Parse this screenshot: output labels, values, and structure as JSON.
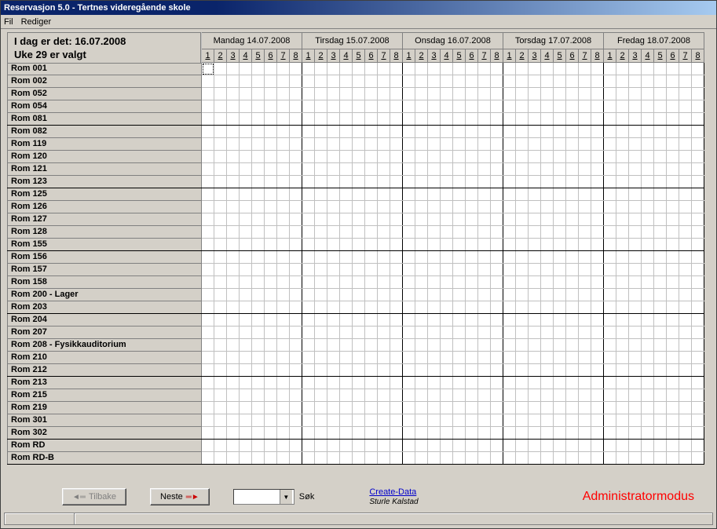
{
  "window": {
    "title": "Reservasjon 5.0 - Tertnes videregående skole"
  },
  "menu": {
    "file": "Fil",
    "edit": "Rediger"
  },
  "info": {
    "today_label": "I dag er det: 16.07.2008",
    "week_label": "Uke 29 er valgt"
  },
  "days": [
    {
      "label": "Mandag 14.07.2008"
    },
    {
      "label": "Tirsdag 15.07.2008"
    },
    {
      "label": "Onsdag 16.07.2008"
    },
    {
      "label": "Torsdag 17.07.2008"
    },
    {
      "label": "Fredag 18.07.2008"
    }
  ],
  "periods": [
    "1",
    "2",
    "3",
    "4",
    "5",
    "6",
    "7",
    "8"
  ],
  "rooms": [
    "Rom 001",
    "Rom 002",
    "Rom 052",
    "Rom 054",
    "Rom 081",
    "Rom 082",
    "Rom 119",
    "Rom 120",
    "Rom 121",
    "Rom 123",
    "Rom 125",
    "Rom 126",
    "Rom 127",
    "Rom 128",
    "Rom 155",
    "Rom 156",
    "Rom 157",
    "Rom 158",
    "Rom 200 - Lager",
    "Rom 203",
    "Rom 204",
    "Rom 207",
    "Rom 208 - Fysikkauditorium",
    "Rom 210",
    "Rom 212",
    "Rom 213",
    "Rom 215",
    "Rom 219",
    "Rom 301",
    "Rom 302",
    "Rom RD",
    "Rom RD-B"
  ],
  "buttons": {
    "back": "Tilbake",
    "next": "Neste",
    "search": "Søk"
  },
  "search": {
    "value": ""
  },
  "link": {
    "label": "Create-Data",
    "author": "Sturle Kalstad"
  },
  "admin_mode": "Administratormodus"
}
